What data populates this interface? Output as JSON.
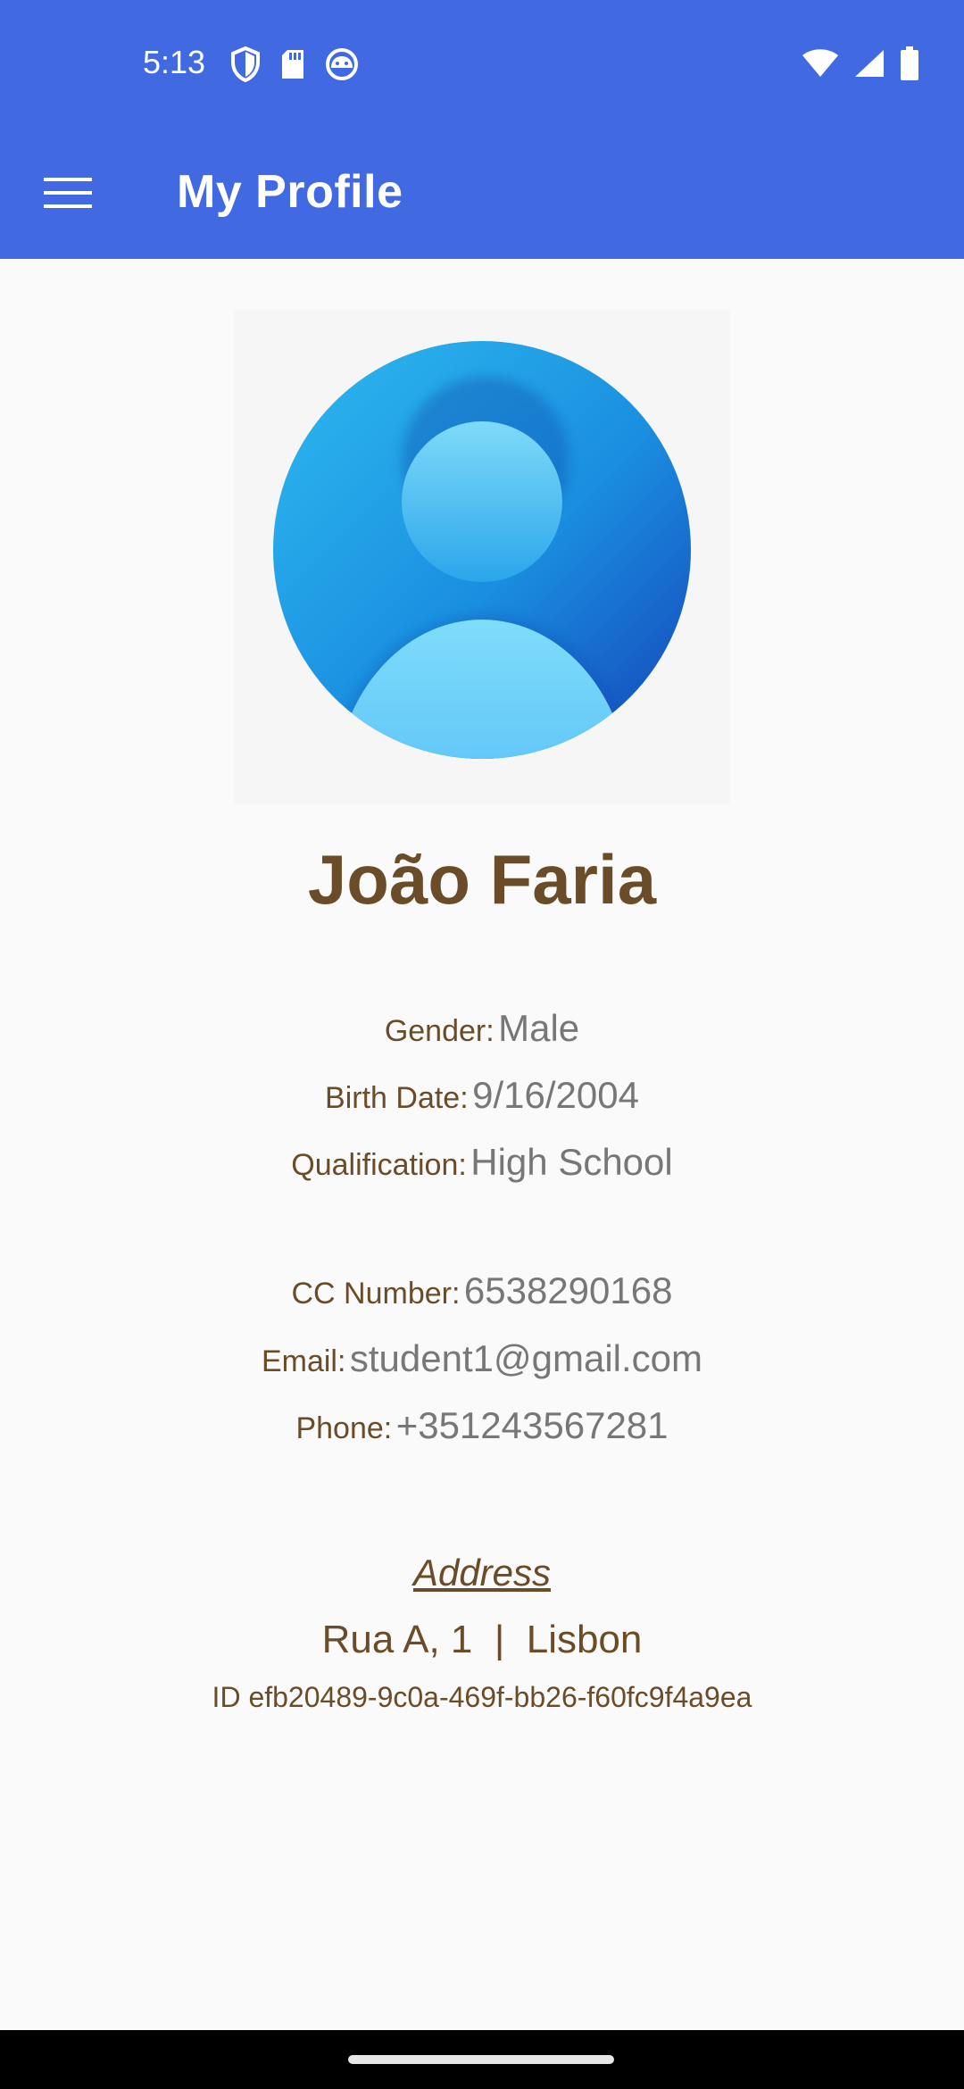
{
  "status_bar": {
    "time": "5:13",
    "left_icons": [
      "shield-icon",
      "sd-card-icon",
      "android-debug-icon"
    ],
    "right_icons": [
      "wifi-icon",
      "cell-signal-icon",
      "battery-icon"
    ]
  },
  "app_bar": {
    "title": "My Profile",
    "menu_icon": "hamburger-menu-icon",
    "color": "#4169e1"
  },
  "profile": {
    "avatar_icon": "person-avatar-icon",
    "name": "João Faria",
    "personal": [
      {
        "label": "Gender:",
        "value": "Male"
      },
      {
        "label": "Birth Date:",
        "value": "9/16/2004"
      },
      {
        "label": "Qualification:",
        "value": "High School"
      }
    ],
    "contact": [
      {
        "label": "CC Number:",
        "value": "6538290168"
      },
      {
        "label": "Email:",
        "value": "student1@gmail.com"
      },
      {
        "label": "Phone:",
        "value": "+351243567281"
      }
    ],
    "address_heading": "Address",
    "address": "Rua A, 1  |  Lisbon",
    "id_text": "ID efb20489-9c0a-469f-bb26-f60fc9f4a9ea"
  },
  "colors": {
    "label_brown": "#6a4c28",
    "value_gray": "#777777",
    "background": "#fafafa"
  }
}
